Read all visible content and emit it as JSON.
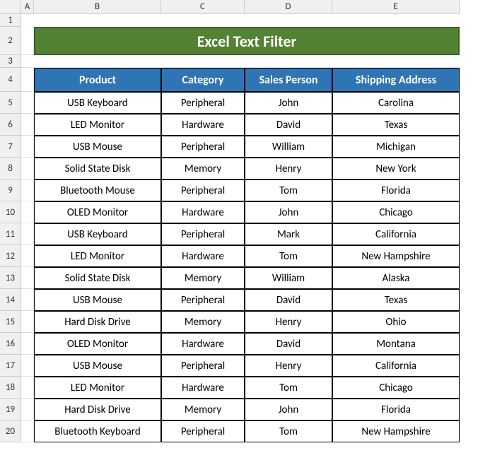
{
  "columns": [
    "A",
    "B",
    "C",
    "D",
    "E"
  ],
  "rows": [
    "1",
    "2",
    "3",
    "4",
    "5",
    "6",
    "7",
    "8",
    "9",
    "10",
    "11",
    "12",
    "13",
    "14",
    "15",
    "16",
    "17",
    "18",
    "19",
    "20"
  ],
  "title": "Excel Text Filter",
  "headers": {
    "b": "Product",
    "c": "Category",
    "d": "Sales Person",
    "e": "Shipping Address"
  },
  "data": [
    {
      "b": "USB Keyboard",
      "c": "Peripheral",
      "d": "John",
      "e": "Carolina"
    },
    {
      "b": "LED Monitor",
      "c": "Hardware",
      "d": "David",
      "e": "Texas"
    },
    {
      "b": "USB Mouse",
      "c": "Peripheral",
      "d": "William",
      "e": "Michigan"
    },
    {
      "b": "Solid State Disk",
      "c": "Memory",
      "d": "Henry",
      "e": "New York"
    },
    {
      "b": "Bluetooth Mouse",
      "c": "Peripheral",
      "d": "Tom",
      "e": "Florida"
    },
    {
      "b": "OLED Monitor",
      "c": "Hardware",
      "d": "John",
      "e": "Chicago"
    },
    {
      "b": "USB Keyboard",
      "c": "Peripheral",
      "d": "Mark",
      "e": "California"
    },
    {
      "b": "LED Monitor",
      "c": "Hardware",
      "d": "Tom",
      "e": "New Hampshire"
    },
    {
      "b": "Solid State Disk",
      "c": "Memory",
      "d": "William",
      "e": "Alaska"
    },
    {
      "b": "USB Mouse",
      "c": "Peripheral",
      "d": "David",
      "e": "Texas"
    },
    {
      "b": "Hard Disk Drive",
      "c": "Memory",
      "d": "Henry",
      "e": "Ohio"
    },
    {
      "b": "OLED Monitor",
      "c": "Hardware",
      "d": "David",
      "e": "Montana"
    },
    {
      "b": "USB Mouse",
      "c": "Peripheral",
      "d": "Henry",
      "e": "California"
    },
    {
      "b": "LED Monitor",
      "c": "Hardware",
      "d": "Tom",
      "e": "Chicago"
    },
    {
      "b": "Hard Disk Drive",
      "c": "Memory",
      "d": "John",
      "e": "Florida"
    },
    {
      "b": "Bluetooth Keyboard",
      "c": "Peripheral",
      "d": "Tom",
      "e": "New Hampshire"
    }
  ]
}
